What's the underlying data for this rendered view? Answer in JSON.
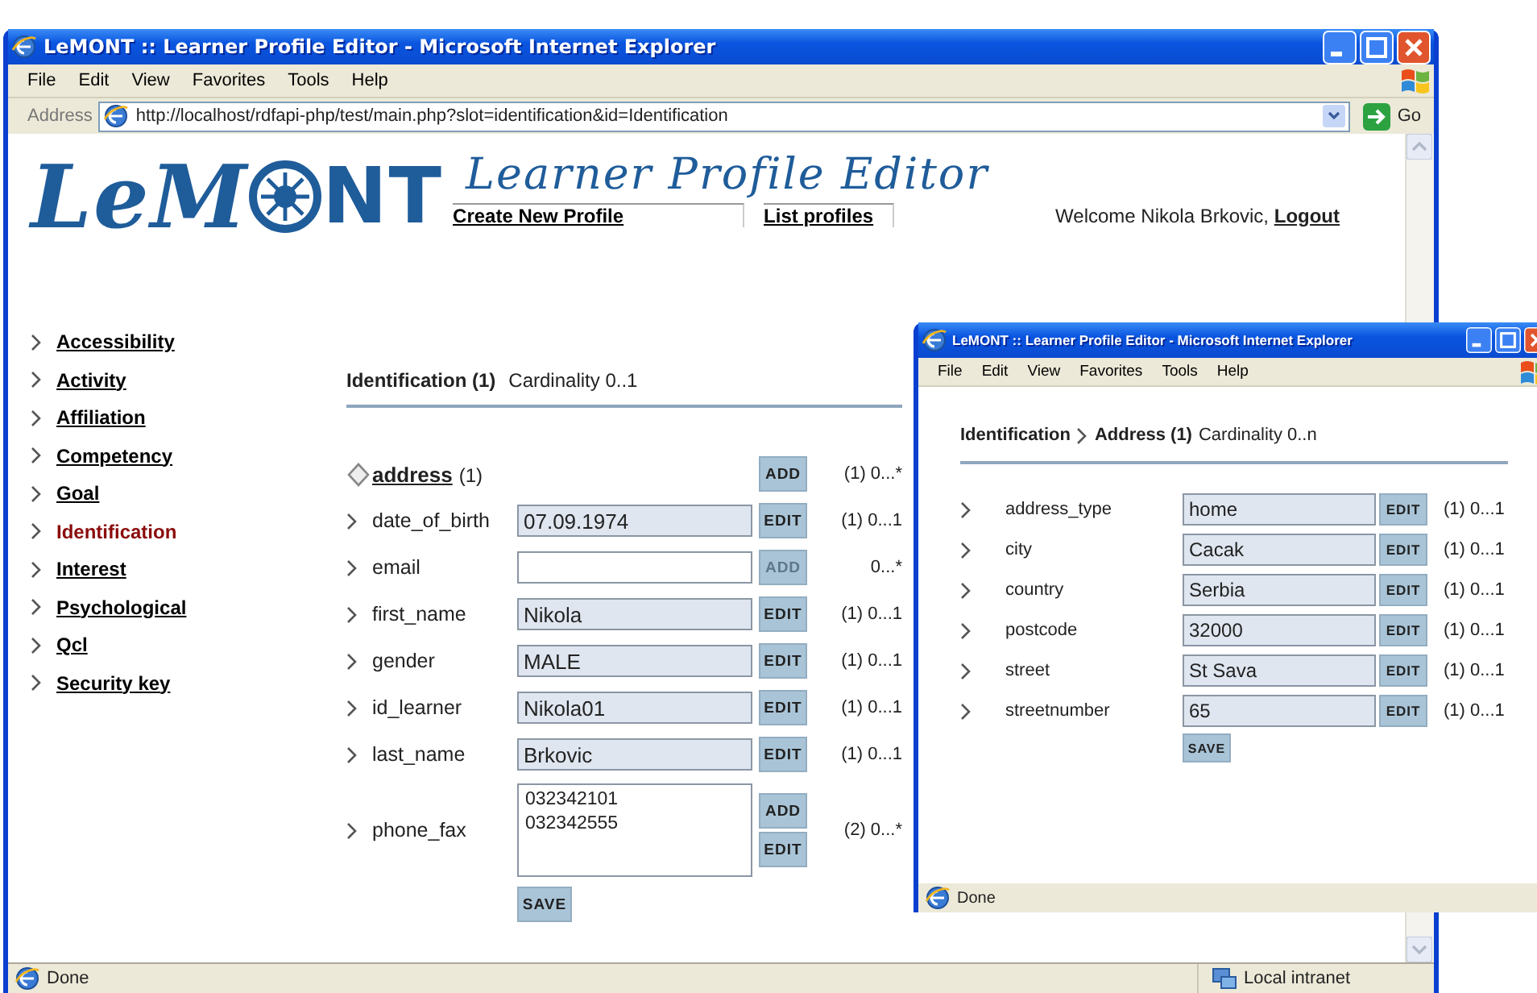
{
  "window": {
    "title": "LeMONT :: Learner Profile Editor - Microsoft Internet Explorer",
    "menu": [
      "File",
      "Edit",
      "View",
      "Favorites",
      "Tools",
      "Help"
    ],
    "address_label": "Address",
    "url": "http://localhost/rdfapi-php/test/main.php?slot=identification&id=Identification",
    "go": "Go"
  },
  "header": {
    "logo_left": "LeM",
    "logo_right": "NT",
    "app_title": "Learner Profile Editor",
    "links": [
      "Create New Profile",
      "List profiles"
    ],
    "welcome": "Welcome Nikola Brkovic, ",
    "logout": "Logout"
  },
  "sidebar": {
    "items": [
      {
        "label": "Accessibility",
        "selected": false
      },
      {
        "label": "Activity",
        "selected": false
      },
      {
        "label": "Affiliation",
        "selected": false
      },
      {
        "label": "Competency",
        "selected": false
      },
      {
        "label": "Goal",
        "selected": false
      },
      {
        "label": "Identification",
        "selected": true
      },
      {
        "label": "Interest",
        "selected": false
      },
      {
        "label": "Psychological",
        "selected": false
      },
      {
        "label": "Qcl",
        "selected": false
      },
      {
        "label": "Security key",
        "selected": false
      }
    ]
  },
  "form": {
    "title": "Identification (1)",
    "cardinality": "Cardinality 0..1",
    "rows": [
      {
        "kind": "group",
        "label": "address",
        "note": "(1)",
        "buttons": [
          {
            "label": "ADD",
            "disabled": false
          }
        ],
        "count": "(1) 0...*"
      },
      {
        "kind": "field",
        "label": "date_of_birth",
        "value": "07.09.1974",
        "buttons": [
          {
            "label": "EDIT",
            "disabled": false
          }
        ],
        "count": "(1) 0...1"
      },
      {
        "kind": "field",
        "label": "email",
        "buttons": [
          {
            "label": "ADD",
            "disabled": true
          }
        ],
        "count": "0...*"
      },
      {
        "kind": "field",
        "label": "first_name",
        "value": "Nikola",
        "buttons": [
          {
            "label": "EDIT",
            "disabled": false
          }
        ],
        "count": "(1) 0...1"
      },
      {
        "kind": "field",
        "label": "gender",
        "value": "MALE",
        "buttons": [
          {
            "label": "EDIT",
            "disabled": false
          }
        ],
        "count": "(1) 0...1"
      },
      {
        "kind": "field",
        "label": "id_learner",
        "value": "Nikola01",
        "buttons": [
          {
            "label": "EDIT",
            "disabled": false
          }
        ],
        "count": "(1) 0...1"
      },
      {
        "kind": "field",
        "label": "last_name",
        "value": "Brkovic",
        "buttons": [
          {
            "label": "EDIT",
            "disabled": false
          }
        ],
        "count": "(1) 0...1"
      },
      {
        "kind": "list",
        "label": "phone_fax",
        "values": [
          "032342101",
          "032342555"
        ],
        "buttons": [
          {
            "label": "ADD",
            "disabled": false
          },
          {
            "label": "EDIT",
            "disabled": false
          }
        ],
        "count": "(2) 0...*"
      }
    ],
    "save": "SAVE"
  },
  "status_bar": {
    "text": "Done",
    "zone": "Local intranet"
  },
  "popup": {
    "title": "LeMONT :: Learner Profile Editor - Microsoft Internet Explorer",
    "menu": [
      "File",
      "Edit",
      "View",
      "Favorites",
      "Tools",
      "Help"
    ],
    "breadcrumb": {
      "parent": "Identification",
      "current": "Address (1)",
      "cardinality": "Cardinality 0..n"
    },
    "rows": [
      {
        "label": "address_type",
        "value": "home",
        "button": "EDIT",
        "count": "(1) 0...1"
      },
      {
        "label": "city",
        "value": "Cacak",
        "button": "EDIT",
        "count": "(1) 0...1"
      },
      {
        "label": "country",
        "value": "Serbia",
        "button": "EDIT",
        "count": "(1) 0...1"
      },
      {
        "label": "postcode",
        "value": "32000",
        "button": "EDIT",
        "count": "(1) 0...1"
      },
      {
        "label": "street",
        "value": "St Sava",
        "button": "EDIT",
        "count": "(1) 0...1"
      },
      {
        "label": "streetnumber",
        "value": "65",
        "button": "EDIT",
        "count": "(1) 0...1"
      }
    ],
    "save": "SAVE",
    "status_bar": {
      "text": "Done"
    }
  }
}
